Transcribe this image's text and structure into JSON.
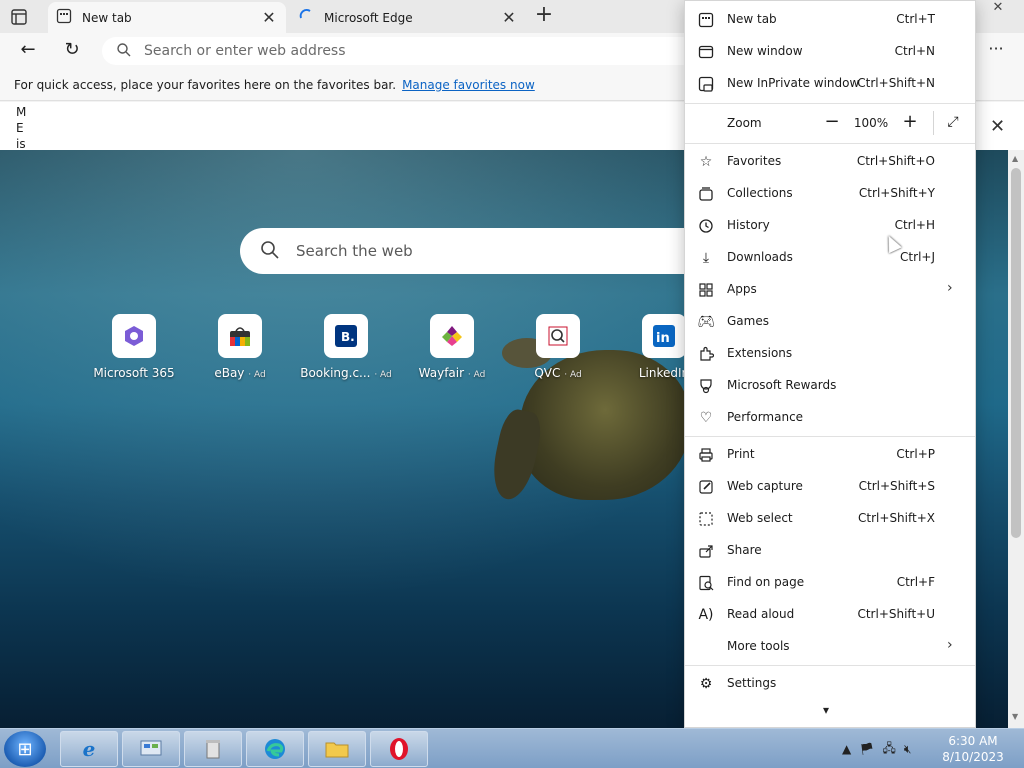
{
  "tabs": [
    {
      "title": "New tab",
      "active": true
    },
    {
      "title": "Microsoft Edge",
      "active": false
    }
  ],
  "address_bar": {
    "placeholder": "Search or enter web address"
  },
  "favorites_bar": {
    "text": "For quick access, place your favorites here on the favorites bar.",
    "link": "Manage favorites now"
  },
  "notice": {
    "text": "M E is"
  },
  "ntp": {
    "search_placeholder": "Search the web",
    "quick_links": [
      {
        "label": "Microsoft 365",
        "ad": "",
        "icon": "microsoft-365-icon"
      },
      {
        "label": "eBay",
        "ad": "· Ad",
        "icon": "ebay-icon"
      },
      {
        "label": "Booking.c...",
        "ad": "· Ad",
        "icon": "booking-icon"
      },
      {
        "label": "Wayfair",
        "ad": "· Ad",
        "icon": "wayfair-icon"
      },
      {
        "label": "QVC",
        "ad": "· Ad",
        "icon": "qvc-icon"
      },
      {
        "label": "LinkedIn",
        "ad": "",
        "icon": "linkedin-icon"
      }
    ]
  },
  "menu": {
    "items": [
      {
        "label": "New tab",
        "shortcut": "Ctrl+T",
        "icon": "new-tab-icon"
      },
      {
        "label": "New window",
        "shortcut": "Ctrl+N",
        "icon": "new-window-icon"
      },
      {
        "label": "New InPrivate window",
        "shortcut": "Ctrl+Shift+N",
        "icon": "inprivate-icon"
      },
      {
        "label": "Favorites",
        "shortcut": "Ctrl+Shift+O",
        "icon": "star-icon"
      },
      {
        "label": "Collections",
        "shortcut": "Ctrl+Shift+Y",
        "icon": "collections-icon"
      },
      {
        "label": "History",
        "shortcut": "Ctrl+H",
        "icon": "history-icon"
      },
      {
        "label": "Downloads",
        "shortcut": "Ctrl+J",
        "icon": "download-icon"
      },
      {
        "label": "Apps",
        "shortcut": "",
        "icon": "apps-icon"
      },
      {
        "label": "Games",
        "shortcut": "",
        "icon": "games-icon"
      },
      {
        "label": "Extensions",
        "shortcut": "",
        "icon": "extensions-icon"
      },
      {
        "label": "Microsoft Rewards",
        "shortcut": "",
        "icon": "rewards-icon"
      },
      {
        "label": "Performance",
        "shortcut": "",
        "icon": "performance-icon"
      },
      {
        "label": "Print",
        "shortcut": "Ctrl+P",
        "icon": "print-icon"
      },
      {
        "label": "Web capture",
        "shortcut": "Ctrl+Shift+S",
        "icon": "web-capture-icon"
      },
      {
        "label": "Web select",
        "shortcut": "Ctrl+Shift+X",
        "icon": "web-select-icon"
      },
      {
        "label": "Share",
        "shortcut": "",
        "icon": "share-icon"
      },
      {
        "label": "Find on page",
        "shortcut": "Ctrl+F",
        "icon": "find-icon"
      },
      {
        "label": "Read aloud",
        "shortcut": "Ctrl+Shift+U",
        "icon": "read-aloud-icon"
      },
      {
        "label": "More tools",
        "shortcut": "",
        "icon": ""
      },
      {
        "label": "Settings",
        "shortcut": "",
        "icon": "gear-icon"
      }
    ],
    "zoom": {
      "label": "Zoom",
      "value": "100%"
    }
  },
  "taskbar": {
    "clock_time": "6:30 AM",
    "clock_date": "8/10/2023",
    "apps": [
      "internet-explorer-icon",
      "control-panel-icon",
      "recycle-icon",
      "edge-icon",
      "file-explorer-icon",
      "opera-icon"
    ]
  }
}
